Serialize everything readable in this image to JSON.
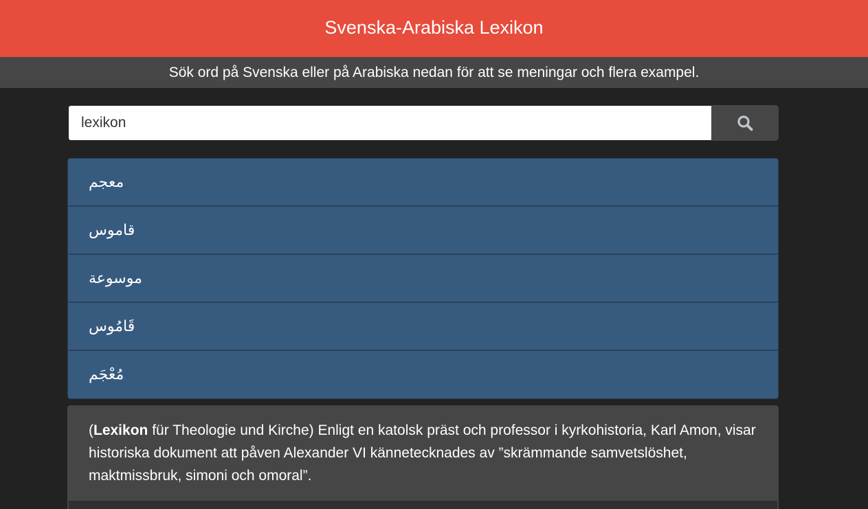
{
  "header": {
    "title": "Svenska-Arabiska Lexikon"
  },
  "subheader": {
    "text": "Sök ord på Svenska eller på Arabiska nedan för att se meningar och flera exampel."
  },
  "search": {
    "value": "lexikon",
    "button_icon": "search-icon"
  },
  "results": [
    {
      "text": "معجم"
    },
    {
      "text": "قاموس"
    },
    {
      "text": "موسوعة"
    },
    {
      "text": "قَامُوس"
    },
    {
      "text": "مُعْجَم"
    }
  ],
  "example": {
    "open_paren": "(",
    "keyword": "Lexikon",
    "rest": " für Theologie und Kirche) Enligt en katolsk präst och professor i kyrkohistoria, Karl Amon, visar historiska dokument att påven Alexander VI kännetecknades av ”skrämmande samvetslöshet, maktmissbruk, simoni och omoral”."
  },
  "colors": {
    "header_bg": "#e74c3c",
    "subheader_bg": "#464646",
    "page_bg": "#222222",
    "result_bg": "#375a7f",
    "card_bg": "#464646"
  }
}
